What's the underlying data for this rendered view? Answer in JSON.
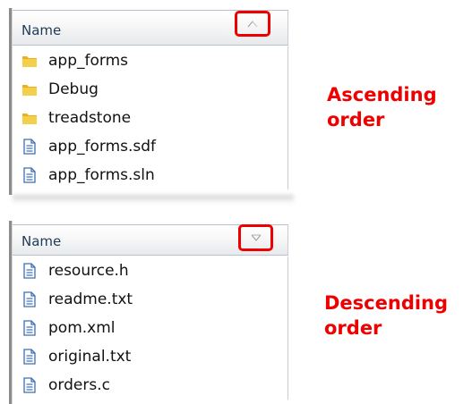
{
  "ascending": {
    "header": {
      "label": "Name",
      "sort_indicator": "sort-ascending-icon"
    },
    "items": [
      {
        "name": "app_forms",
        "icon": "folder-icon"
      },
      {
        "name": "Debug",
        "icon": "folder-icon"
      },
      {
        "name": "treadstone",
        "icon": "folder-icon"
      },
      {
        "name": "app_forms.sdf",
        "icon": "document-icon"
      },
      {
        "name": "app_forms.sln",
        "icon": "document-icon"
      }
    ],
    "caption_line1": "Ascending",
    "caption_line2": "order"
  },
  "descending": {
    "header": {
      "label": "Name",
      "sort_indicator": "sort-descending-icon"
    },
    "items": [
      {
        "name": "resource.h",
        "icon": "document-icon"
      },
      {
        "name": "readme.txt",
        "icon": "document-icon"
      },
      {
        "name": "pom.xml",
        "icon": "document-icon"
      },
      {
        "name": "original.txt",
        "icon": "document-icon"
      },
      {
        "name": "orders.c",
        "icon": "document-icon"
      }
    ],
    "caption_line1": "Descending",
    "caption_line2": "order"
  },
  "colors": {
    "highlight": "#ef0000",
    "caption": "#ee0000",
    "folder": "#f2c12e",
    "document": "#3b6fb6"
  }
}
